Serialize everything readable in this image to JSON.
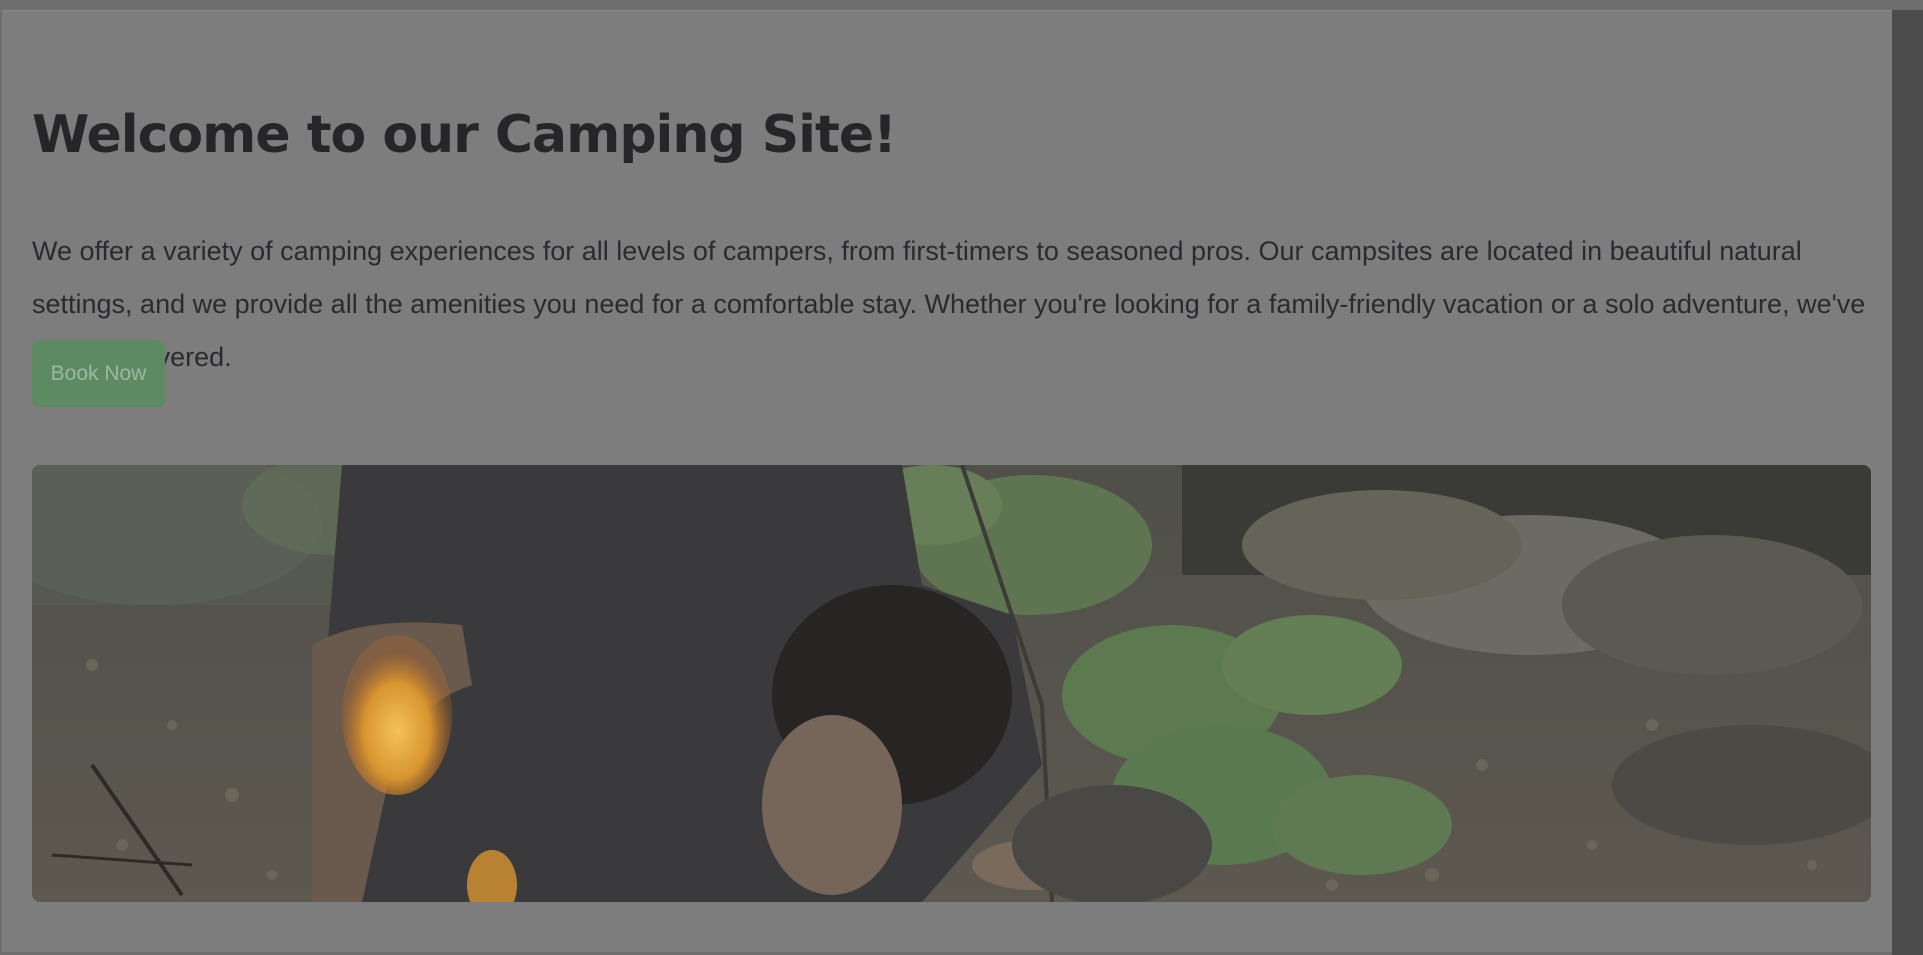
{
  "hero_section": {
    "heading": "Welcome to our Camping Site!",
    "description": "We offer a variety of camping experiences for all levels of campers, from first-timers to seasoned pros. Our campsites are located in beautiful natural settings, and we provide all the amenities you need for a comfortable stay. Whether you're looking for a family-friendly vacation or a solo adventure, we've got you covered.",
    "button_label": "Book Now",
    "image_subject": "camper lighting a campfire in the woods"
  },
  "colors": {
    "page_background": "#7d7d7d",
    "heading_text": "#262628",
    "body_text": "#2b2b2f",
    "button_background": "#5d8a63",
    "button_text": "#9db8a0",
    "scrollbar": "#4c4c4c"
  }
}
